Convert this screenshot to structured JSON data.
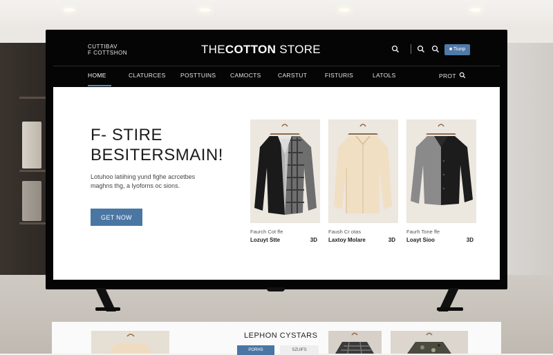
{
  "header": {
    "brand_small_line1": "CUTTIBAV",
    "brand_small_line2": "F COTTSHON",
    "logo_thin": "THE",
    "logo_bold": "COTTON",
    "logo_tail": " STORE",
    "account_button": "Tiunp"
  },
  "nav": {
    "items": [
      "HOME",
      "CLATURCES",
      "POSTTUINS",
      "CAMOCTS",
      "CARSTUT",
      "FISTURIS",
      "LATOLS"
    ],
    "right": "PROT"
  },
  "hero": {
    "title_line1": "F- STIRE",
    "title_line2": "BESITERSMAIN!",
    "desc_line1": "Lotuhoo latiihing yund fighe acrcetbes",
    "desc_line2": "maghns thg, a lyoforns oc sions.",
    "cta": "GET NOW"
  },
  "products": [
    {
      "name": "Faurch Cot ffe",
      "title": "Lozuyt Stte",
      "price": "3D"
    },
    {
      "name": "Faush Cr otas",
      "title": "Laxtoy Molare",
      "price": "3D"
    },
    {
      "name": "Faurh Tone ffe",
      "title": "Loayt Sioo",
      "price": "3D"
    }
  ],
  "lower": {
    "title": "LEPHON CYSTARS",
    "btn1": "PORHS",
    "btn2": "SZUIFS"
  },
  "colors": {
    "accent": "#4a76a4",
    "nav_underline": "#5d86b6",
    "header_bg": "#050505"
  }
}
